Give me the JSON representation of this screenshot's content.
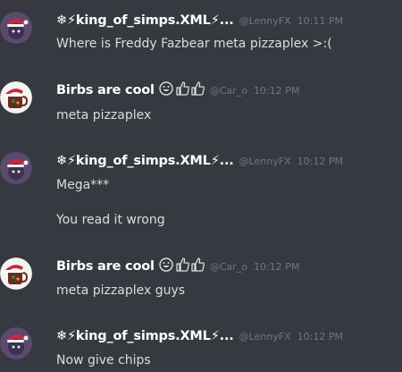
{
  "messages": [
    {
      "username": "❄⚡king_of_simps.XML⚡...",
      "handle": "@LennyFX",
      "time": "10:11 PM",
      "lines": [
        "Where is Freddy Fazbear meta pizzaplex >:("
      ],
      "avatar": "santa-hat-avatar"
    },
    {
      "username": "Birbs are cool",
      "handle": "@Car_o",
      "time": "10:12 PM",
      "lines": [
        "meta pizzaplex"
      ],
      "avatar": "mug-avatar"
    },
    {
      "username": "❄⚡king_of_simps.XML⚡...",
      "handle": "@LennyFX",
      "time": "10:12 PM",
      "lines": [
        "Mega***",
        "You read it wrong"
      ],
      "avatar": "santa-hat-avatar"
    },
    {
      "username": "Birbs are cool",
      "handle": "@Car_o",
      "time": "10:12 PM",
      "lines": [
        "meta pizzaplex guys"
      ],
      "avatar": "mug-avatar"
    },
    {
      "username": "❄⚡king_of_simps.XML⚡...",
      "handle": "@LennyFX",
      "time": "10:12 PM",
      "lines": [
        "Now give chips"
      ],
      "avatar": "santa-hat-avatar"
    }
  ],
  "colors": {
    "background": "#36393f",
    "username": "#ffffff",
    "meta": "#72767d",
    "text": "#dcddde"
  }
}
